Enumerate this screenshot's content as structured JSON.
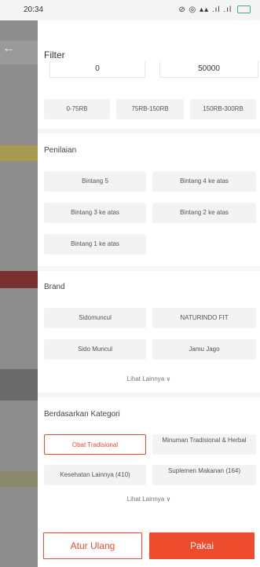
{
  "status_bar": {
    "time": "20:34",
    "icons": "⊘ ◎ ▴▴ .ıl .ıl"
  },
  "drawer": {
    "title": "Filter"
  },
  "price": {
    "min_value": "0",
    "max_value": "50000",
    "ranges": [
      "0-75RB",
      "75RB-150RB",
      "150RB-300RB"
    ]
  },
  "rating": {
    "title": "Penilaian",
    "options": [
      "Bintang 5",
      "Bintang 4 ke atas",
      "Bintang 3 ke atas",
      "Bintang 2 ke atas",
      "Bintang 1 ke atas"
    ]
  },
  "brand": {
    "title": "Brand",
    "options": [
      "Sidomuncul",
      "NATURINDO FIT",
      "Sido Muncul",
      "Jamu Jago"
    ],
    "see_more": "Lihat Lainnya ∨"
  },
  "category": {
    "title": "Berdasarkan Kategori",
    "options": [
      "Obat Tradisional",
      "Minuman Tradisional & Herbal",
      "Kesehatan Lainnya (410)",
      "Suplemen Makanan (164)"
    ],
    "see_more": "Lihat Lainnya ∨"
  },
  "footer": {
    "reset_label": "Atur Ulang",
    "apply_label": "Pakai"
  },
  "colors": {
    "accent": "#ee4d2d",
    "chip_bg": "#f3f3f3"
  }
}
